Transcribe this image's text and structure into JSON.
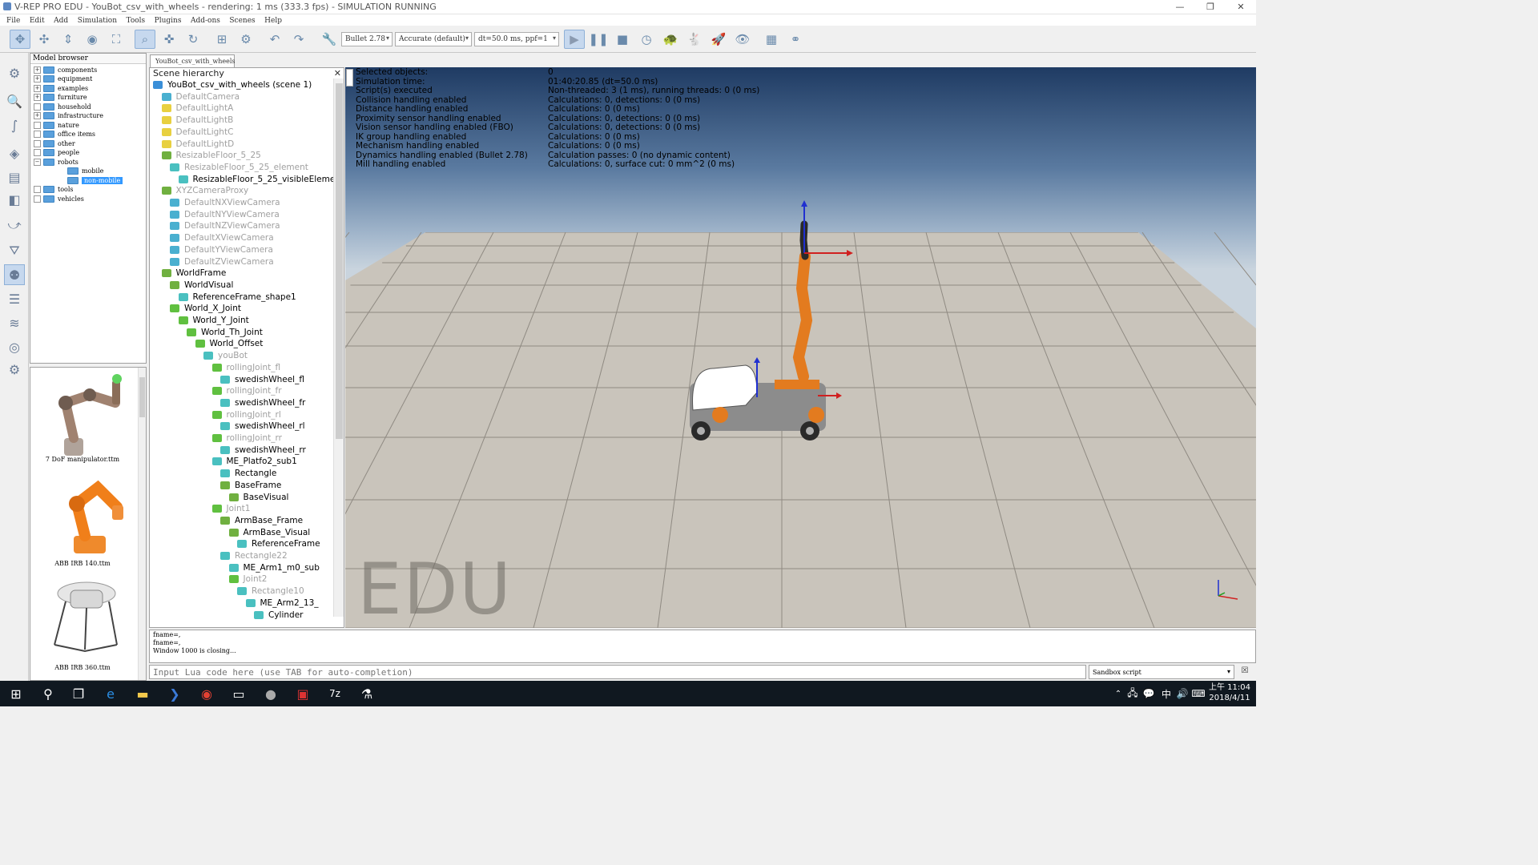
{
  "window": {
    "title": "V-REP PRO EDU - YouBot_csv_with_wheels - rendering: 1 ms (333.3 fps) - SIMULATION RUNNING"
  },
  "menu": [
    "File",
    "Edit",
    "Add",
    "Simulation",
    "Tools",
    "Plugins",
    "Add-ons",
    "Scenes",
    "Help"
  ],
  "toolbar": {
    "engine": "Bullet 2.78",
    "accuracy": "Accurate (default)",
    "timestep": "dt=50.0 ms, ppf=1"
  },
  "model_browser": {
    "header": "Model browser",
    "folders": [
      {
        "label": "components",
        "expander": "+"
      },
      {
        "label": "equipment",
        "expander": "+"
      },
      {
        "label": "examples",
        "expander": "+"
      },
      {
        "label": "furniture",
        "expander": "+"
      },
      {
        "label": "household",
        "expander": ""
      },
      {
        "label": "infrastructure",
        "expander": "+"
      },
      {
        "label": "nature",
        "expander": ""
      },
      {
        "label": "office items",
        "expander": ""
      },
      {
        "label": "other",
        "expander": ""
      },
      {
        "label": "people",
        "expander": ""
      },
      {
        "label": "robots",
        "expander": "−"
      },
      {
        "label": "mobile",
        "expander": ""
      },
      {
        "label": "non-mobile",
        "expander": ""
      },
      {
        "label": "tools",
        "expander": ""
      },
      {
        "label": "vehicles",
        "expander": ""
      }
    ],
    "thumbnails": [
      "7 DoF manipulator.ttm",
      "ABB IRB 140.ttm",
      "ABB IRB 360.ttm"
    ]
  },
  "scene_tab": "YouBot_csv_with_wheels",
  "hierarchy": {
    "title": "Scene hierarchy",
    "items": [
      {
        "label": "YouBot_csv_with_wheels (scene 1)",
        "color": "#3a8fd8"
      },
      {
        "label": "DefaultCamera",
        "color": "#4ab0d0"
      },
      {
        "label": "DefaultLightA",
        "color": "#e8d040"
      },
      {
        "label": "DefaultLightB",
        "color": "#e8d040"
      },
      {
        "label": "DefaultLightC",
        "color": "#e8d040"
      },
      {
        "label": "DefaultLightD",
        "color": "#e8d040"
      },
      {
        "label": "ResizableFloor_5_25",
        "color": "#70b040"
      },
      {
        "label": "ResizableFloor_5_25_element",
        "color": "#4ac0c0"
      },
      {
        "label": "ResizableFloor_5_25_visibleElement",
        "color": "#4ac0c0"
      },
      {
        "label": "XYZCameraProxy",
        "color": "#70b040"
      },
      {
        "label": "DefaultNXViewCamera",
        "color": "#4ab0d0"
      },
      {
        "label": "DefaultNYViewCamera",
        "color": "#4ab0d0"
      },
      {
        "label": "DefaultNZViewCamera",
        "color": "#4ab0d0"
      },
      {
        "label": "DefaultXViewCamera",
        "color": "#4ab0d0"
      },
      {
        "label": "DefaultYViewCamera",
        "color": "#4ab0d0"
      },
      {
        "label": "DefaultZViewCamera",
        "color": "#4ab0d0"
      },
      {
        "label": "WorldFrame",
        "color": "#70b040"
      },
      {
        "label": "WorldVisual",
        "color": "#70b040"
      },
      {
        "label": "ReferenceFrame_shape1",
        "color": "#4ac0c0"
      },
      {
        "label": "World_X_Joint",
        "color": "#60c040"
      },
      {
        "label": "World_Y_Joint",
        "color": "#60c040"
      },
      {
        "label": "World_Th_Joint",
        "color": "#60c040"
      },
      {
        "label": "World_Offset",
        "color": "#60c040"
      },
      {
        "label": "youBot",
        "color": "#4ac0c0"
      },
      {
        "label": "rollingJoint_fl",
        "color": "#60c040"
      },
      {
        "label": "swedishWheel_fl",
        "color": "#4ac0c0"
      },
      {
        "label": "rollingJoint_fr",
        "color": "#60c040"
      },
      {
        "label": "swedishWheel_fr",
        "color": "#4ac0c0"
      },
      {
        "label": "rollingJoint_rl",
        "color": "#60c040"
      },
      {
        "label": "swedishWheel_rl",
        "color": "#4ac0c0"
      },
      {
        "label": "rollingJoint_rr",
        "color": "#60c040"
      },
      {
        "label": "swedishWheel_rr",
        "color": "#4ac0c0"
      },
      {
        "label": "ME_Platfo2_sub1",
        "color": "#4ac0c0"
      },
      {
        "label": "Rectangle",
        "color": "#4ac0c0"
      },
      {
        "label": "BaseFrame",
        "color": "#70b040"
      },
      {
        "label": "BaseVisual",
        "color": "#70b040"
      },
      {
        "label": "Joint1",
        "color": "#60c040"
      },
      {
        "label": "ArmBase_Frame",
        "color": "#70b040"
      },
      {
        "label": "ArmBase_Visual",
        "color": "#70b040"
      },
      {
        "label": "ReferenceFrame",
        "color": "#4ac0c0"
      },
      {
        "label": "Rectangle22",
        "color": "#4ac0c0"
      },
      {
        "label": "ME_Arm1_m0_sub",
        "color": "#4ac0c0"
      },
      {
        "label": "Joint2",
        "color": "#60c040"
      },
      {
        "label": "Rectangle10",
        "color": "#4ac0c0"
      },
      {
        "label": "ME_Arm2_13_",
        "color": "#4ac0c0"
      },
      {
        "label": "Cylinder",
        "color": "#4ac0c0"
      }
    ]
  },
  "sim_info": [
    {
      "label": "Selected objects:",
      "value": "0"
    },
    {
      "label": "Simulation time:",
      "value": "01:40:20.85 (dt=50.0 ms)"
    },
    {
      "label": "Script(s) executed",
      "value": "Non-threaded: 3 (1 ms), running threads: 0 (0 ms)"
    },
    {
      "label": "Collision handling enabled",
      "value": "Calculations: 0, detections: 0 (0 ms)"
    },
    {
      "label": "Distance handling enabled",
      "value": "Calculations: 0 (0 ms)"
    },
    {
      "label": "Proximity sensor handling enabled",
      "value": "Calculations: 0, detections: 0 (0 ms)"
    },
    {
      "label": "Vision sensor handling enabled (FBO)",
      "value": "Calculations: 0, detections: 0 (0 ms)"
    },
    {
      "label": "IK group handling enabled",
      "value": "Calculations: 0 (0 ms)"
    },
    {
      "label": "Mechanism handling enabled",
      "value": "Calculations: 0 (0 ms)"
    },
    {
      "label": "Dynamics handling enabled (Bullet 2.78)",
      "value": "Calculation passes: 0 (no dynamic content)"
    },
    {
      "label": "Mill handling enabled",
      "value": "Calculations: 0, surface cut: 0 mm^2 (0 ms)"
    }
  ],
  "watermark": "EDU",
  "console": [
    "fname=,",
    "fname=,",
    "Window 1000 is closing..."
  ],
  "lua_input_placeholder": "Input Lua code here (use TAB for auto-completion)",
  "script_select": "Sandbox script",
  "clock": {
    "time": "上午 11:04",
    "date": "2018/4/11"
  },
  "tray": {
    "ime": "中"
  }
}
